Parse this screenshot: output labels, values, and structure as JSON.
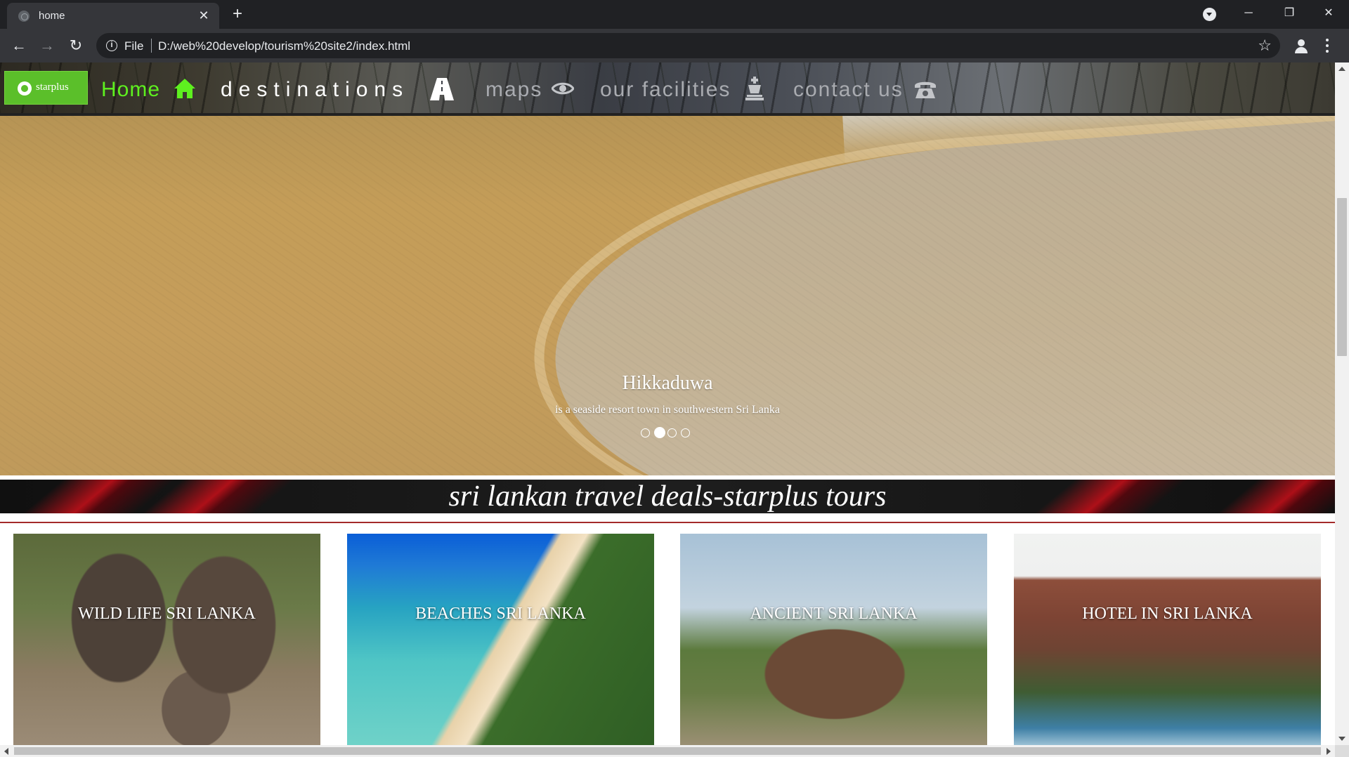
{
  "browser": {
    "tab_title": "home",
    "tab_close": "✕",
    "new_tab": "+",
    "scheme_label": "File",
    "url": "D:/web%20develop/tourism%20site2/index.html",
    "window_minimize": "─",
    "window_restore": "❐",
    "window_close": "✕"
  },
  "site": {
    "logo_text": "starplus",
    "nav": {
      "home": "Home",
      "destinations": "destinations",
      "maps": "maps",
      "facilities": "our facilities",
      "contact": "contact us"
    },
    "colors": {
      "nav_active": "#5ef01f",
      "logo_bg": "#5bbf2a",
      "rule": "#a42a2a"
    }
  },
  "carousel": {
    "slide_title": "Hikkaduwa",
    "slide_text": "is a seaside resort town in southwestern Sri Lanka",
    "slide_count": 4,
    "active_index": 1
  },
  "banner": {
    "title": "sri lankan travel deals-starplus tours"
  },
  "cards": [
    {
      "label": "WILD LIFE SRI LANKA"
    },
    {
      "label": "BEACHES SRI LANKA"
    },
    {
      "label": "ANCIENT SRI LANKA"
    },
    {
      "label": "HOTEL IN SRI LANKA"
    }
  ]
}
